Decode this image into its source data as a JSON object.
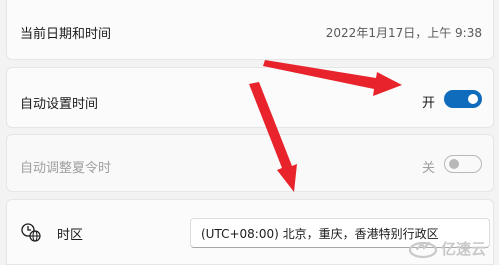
{
  "date_time": {
    "label": "当前日期和时间",
    "value": "2022年1月17日，上午 9:38"
  },
  "auto_time": {
    "label": "自动设置时间",
    "state_text": "开",
    "enabled": true,
    "accent_color": "#0f6cbd"
  },
  "auto_dst": {
    "label": "自动调整夏令时",
    "state_text": "关",
    "enabled": false,
    "disabled": true
  },
  "timezone": {
    "label": "时区",
    "icon": "clock-globe-icon",
    "selected": "(UTC+08:00) 北京，重庆，香港特别行政区"
  },
  "annotations": {
    "arrow_color": "#e8232b",
    "arrow_count": 2
  },
  "watermark": {
    "text": "亿速云",
    "icon": "cloud-logo-icon"
  }
}
